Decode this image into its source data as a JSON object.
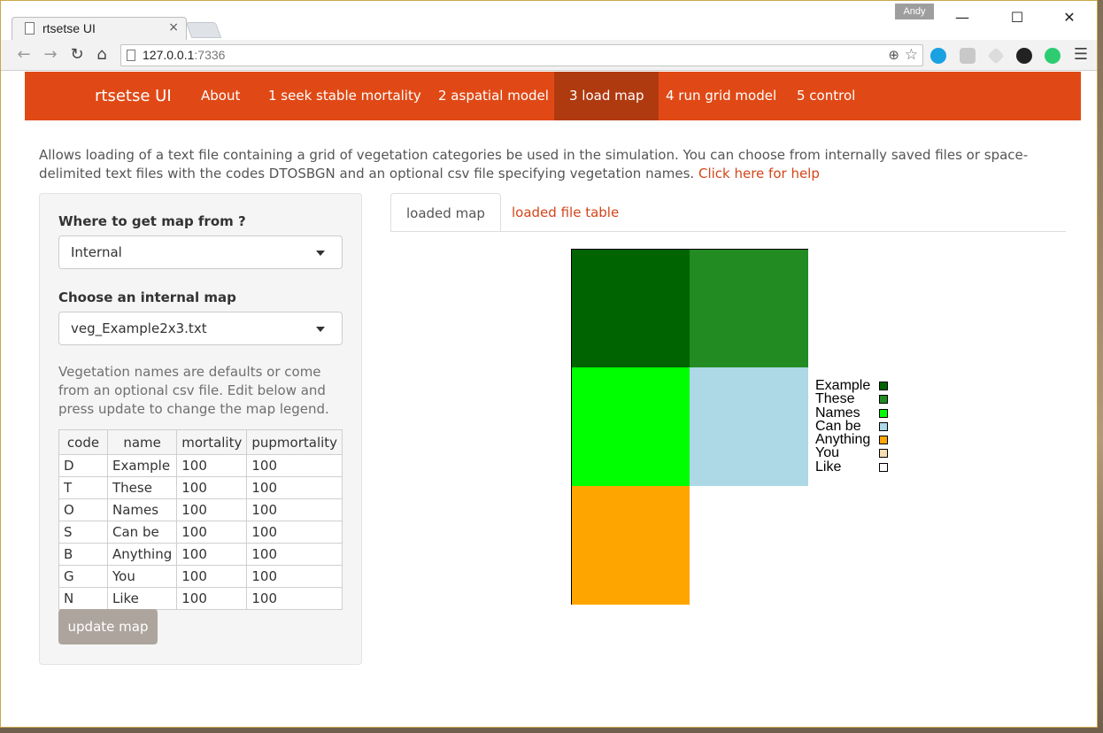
{
  "browser": {
    "tab_title": "rtsetse UI",
    "tab_close": "×",
    "user": "Andy",
    "url_host": "127.0.0.1",
    "url_port": ":7336"
  },
  "navbar": {
    "brand": "rtsetse UI",
    "items": [
      {
        "label": "About"
      },
      {
        "label": "1 seek stable mortality"
      },
      {
        "label": "2 aspatial model"
      },
      {
        "label": "3 load map"
      },
      {
        "label": "4 run grid model"
      },
      {
        "label": "5 control"
      }
    ],
    "active_index": 3
  },
  "intro": {
    "text": "Allows loading of a text file containing a grid of vegetation categories be used in the simulation. You can choose from internally saved files or space-delimited text files with the codes DTOSBGN and an optional csv file specifying vegetation names. ",
    "help_link": "Click here for help"
  },
  "panel": {
    "source_label": "Where to get map from ?",
    "source_value": "Internal",
    "map_label": "Choose an internal map",
    "map_value": "veg_Example2x3.txt",
    "note": "Vegetation names are defaults or come from an optional csv file. Edit below and press update to change the map legend.",
    "table": {
      "headers": [
        "code",
        "name",
        "mortality",
        "pupmortality"
      ],
      "rows": [
        [
          "D",
          "Example",
          "100",
          "100"
        ],
        [
          "T",
          "These",
          "100",
          "100"
        ],
        [
          "O",
          "Names",
          "100",
          "100"
        ],
        [
          "S",
          "Can be",
          "100",
          "100"
        ],
        [
          "B",
          "Anything",
          "100",
          "100"
        ],
        [
          "G",
          "You",
          "100",
          "100"
        ],
        [
          "N",
          "Like",
          "100",
          "100"
        ]
      ]
    },
    "update_button": "update map"
  },
  "tabs": [
    {
      "label": "loaded map",
      "active": true
    },
    {
      "label": "loaded file table",
      "active": false
    }
  ],
  "map": {
    "grid": [
      [
        "#006400",
        "#228b22"
      ],
      [
        "#00ff00",
        "#add8e6"
      ],
      [
        "#ffa500",
        "#ffffff"
      ]
    ],
    "legend": [
      {
        "label": "Example",
        "color": "#006400"
      },
      {
        "label": "These",
        "color": "#228b22"
      },
      {
        "label": "Names",
        "color": "#00ff00"
      },
      {
        "label": "Can be",
        "color": "#add8e6"
      },
      {
        "label": "Anything",
        "color": "#ffa500"
      },
      {
        "label": "You",
        "color": "#f5deb3"
      },
      {
        "label": "Like",
        "color": "#ffffff"
      }
    ]
  }
}
